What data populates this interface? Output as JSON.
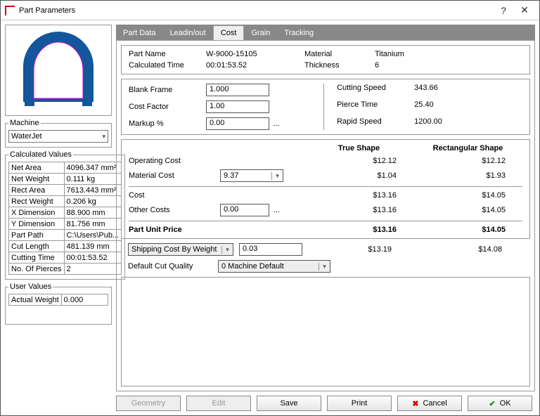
{
  "window": {
    "title": "Part Parameters"
  },
  "tabs": [
    "Part Data",
    "Leadin/out",
    "Cost",
    "Grain",
    "Tracking"
  ],
  "active_tab": "Cost",
  "left": {
    "machine_label": "Machine",
    "machine_value": "WaterJet",
    "calc_label": "Calculated Values",
    "calc": [
      [
        "Net Area",
        "4096.347 mm²"
      ],
      [
        "Net Weight",
        "0.111 kg"
      ],
      [
        "Rect Area",
        "7613.443 mm²"
      ],
      [
        "Rect Weight",
        "0.206 kg"
      ],
      [
        "X Dimension",
        "88.900 mm"
      ],
      [
        "Y Dimension",
        "81.756 mm"
      ],
      [
        "Part Path",
        "C:\\Users\\Pub..."
      ],
      [
        "Cut Length",
        "481.139 mm"
      ],
      [
        "Cutting Time",
        "00:01:53.52"
      ],
      [
        "No. Of Pierces",
        "2"
      ]
    ],
    "user_label": "User Values",
    "user": [
      [
        "Actual Weight",
        "0.000"
      ]
    ]
  },
  "header": {
    "part_name_l": "Part Name",
    "part_name_v": "W-9000-15105",
    "material_l": "Material",
    "material_v": "Titanium",
    "calc_time_l": "Calculated Time",
    "calc_time_v": "00:01:53.52",
    "thickness_l": "Thickness",
    "thickness_v": "6"
  },
  "inputs": {
    "blank_l": "Blank Frame",
    "blank_v": "1.000",
    "costf_l": "Cost Factor",
    "costf_v": "1.00",
    "markup_l": "Markup %",
    "markup_v": "0.00"
  },
  "speeds": {
    "cut_l": "Cutting Speed",
    "cut_v": "343.66",
    "pierce_l": "Pierce Time",
    "pierce_v": "25.40",
    "rapid_l": "Rapid Speed",
    "rapid_v": "1200.00"
  },
  "costs": {
    "col_true": "True Shape",
    "col_rect": "Rectangular Shape",
    "op_l": "Operating Cost",
    "op_t": "$12.12",
    "op_r": "$12.12",
    "mat_l": "Material Cost",
    "mat_in": "9.37",
    "mat_t": "$1.04",
    "mat_r": "$1.93",
    "cost_l": "Cost",
    "cost_t": "$13.16",
    "cost_r": "$14.05",
    "oth_l": "Other Costs",
    "oth_in": "0.00",
    "oth_t": "$13.16",
    "oth_r": "$14.05",
    "unit_l": "Part Unit Price",
    "unit_t": "$13.16",
    "unit_r": "$14.05"
  },
  "ship": {
    "mode": "Shipping Cost By Weight",
    "val": "0.03",
    "t": "$13.19",
    "r": "$14.08"
  },
  "quality": {
    "l": "Default Cut Quality",
    "v": "0 Machine Default"
  },
  "footer": {
    "geometry": "Geometry",
    "edit": "Edit",
    "save": "Save",
    "print": "Print",
    "cancel": "Cancel",
    "ok": "OK"
  }
}
